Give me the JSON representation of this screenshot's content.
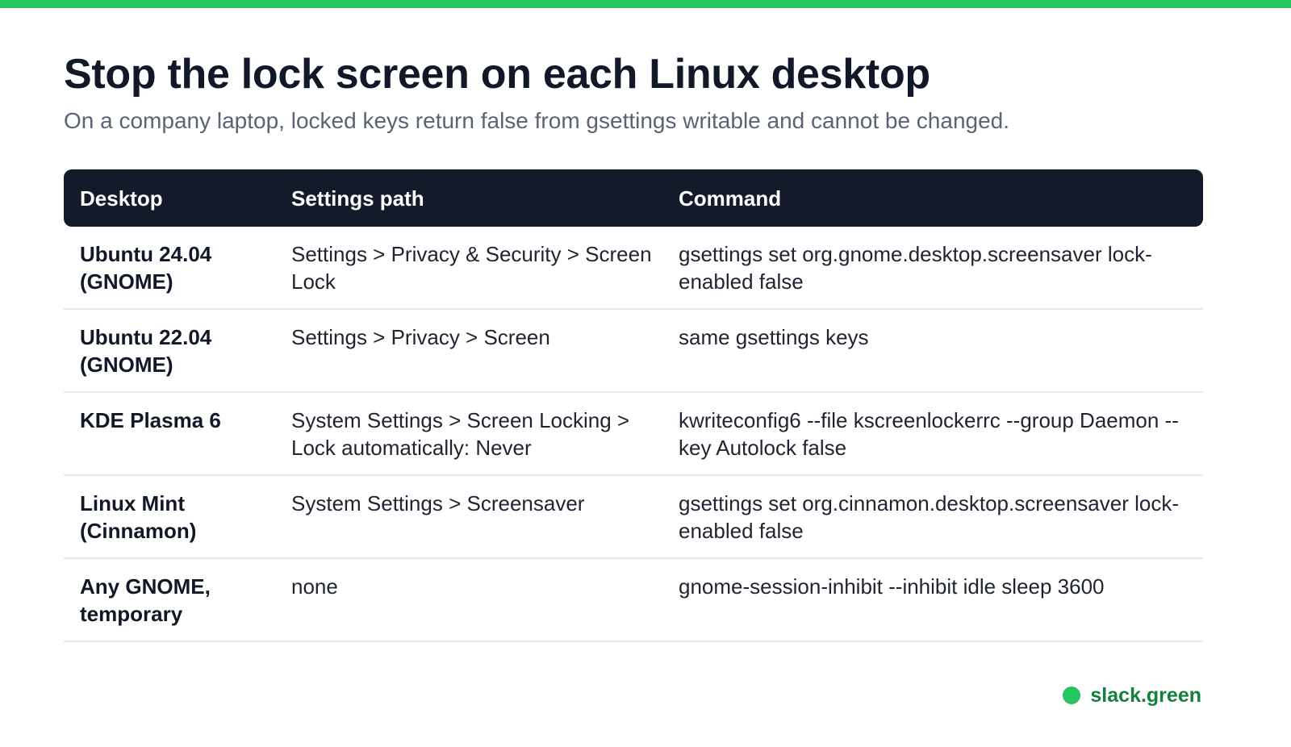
{
  "accent_color": "#22c55e",
  "header_bg_color": "#131a2a",
  "title": "Stop the lock screen on each Linux desktop",
  "subtitle": "On a company laptop, locked keys return false from gsettings writable and cannot be changed.",
  "table": {
    "headers": [
      "Desktop",
      "Settings path",
      "Command"
    ],
    "rows": [
      {
        "desktop": "Ubuntu 24.04 (GNOME)",
        "path": "Settings > Privacy & Security > Screen Lock",
        "command": "gsettings set org.gnome.desktop.screensaver lock-enabled false"
      },
      {
        "desktop": "Ubuntu 22.04 (GNOME)",
        "path": "Settings > Privacy > Screen",
        "command": "same gsettings keys"
      },
      {
        "desktop": "KDE Plasma 6",
        "path": "System Settings > Screen Locking > Lock automatically: Never",
        "command": "kwriteconfig6 --file kscreenlockerrc --group Daemon --key Autolock false"
      },
      {
        "desktop": "Linux Mint (Cinnamon)",
        "path": "System Settings > Screensaver",
        "command": "gsettings set org.cinnamon.desktop.screensaver lock-enabled false"
      },
      {
        "desktop": "Any GNOME, temporary",
        "path": "none",
        "command": "gnome-session-inhibit --inhibit idle sleep 3600"
      }
    ]
  },
  "brand": {
    "icon": "green-dot-icon",
    "name": "slack.green"
  }
}
